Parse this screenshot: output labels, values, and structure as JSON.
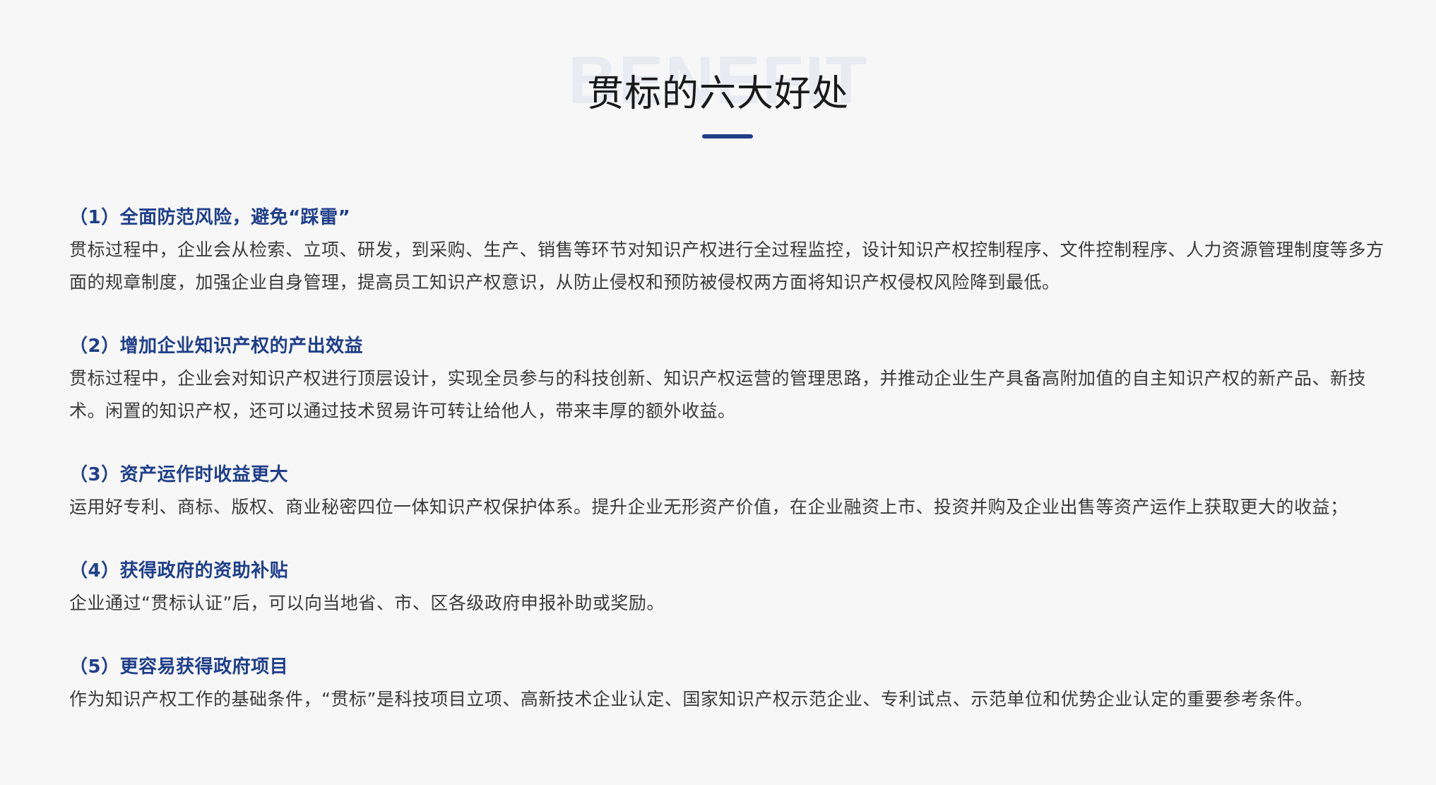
{
  "header": {
    "background_word": "BENEFIT",
    "title": "贯标的六大好处"
  },
  "benefits": [
    {
      "title": "（1）全面防范风险，避免“踩雷”",
      "text": "贯标过程中，企业会从检索、立项、研发，到采购、生产、销售等环节对知识产权进行全过程监控，设计知识产权控制程序、文件控制程序、人力资源管理制度等多方面的规章制度，加强企业自身管理，提高员工知识产权意识，从防止侵权和预防被侵权两方面将知识产权侵权风险降到最低。"
    },
    {
      "title": "（2）增加企业知识产权的产出效益",
      "text": "贯标过程中，企业会对知识产权进行顶层设计，实现全员参与的科技创新、知识产权运营的管理思路，并推动企业生产具备高附加值的自主知识产权的新产品、新技术。闲置的知识产权，还可以通过技术贸易许可转让给他人，带来丰厚的额外收益。"
    },
    {
      "title": "（3）资产运作时收益更大",
      "text": "运用好专利、商标、版权、商业秘密四位一体知识产权保护体系。提升企业无形资产价值，在企业融资上市、投资并购及企业出售等资产运作上获取更大的收益；"
    },
    {
      "title": "（4）获得政府的资助补贴",
      "text": "企业通过“贯标认证”后，可以向当地省、市、区各级政府申报补助或奖励。"
    },
    {
      "title": "（5）更容易获得政府项目",
      "text": "作为知识产权工作的基础条件，“贯标”是科技项目立项、高新技术企业认定、国家知识产权示范企业、专利试点、示范单位和优势企业认定的重要参考条件。"
    }
  ],
  "colors": {
    "accent": "#1f3f8a",
    "background": "#f7f7f8",
    "body_text": "#3a3a3a",
    "title_text": "#1a1a1a",
    "watermark": "#e8ebf2"
  }
}
